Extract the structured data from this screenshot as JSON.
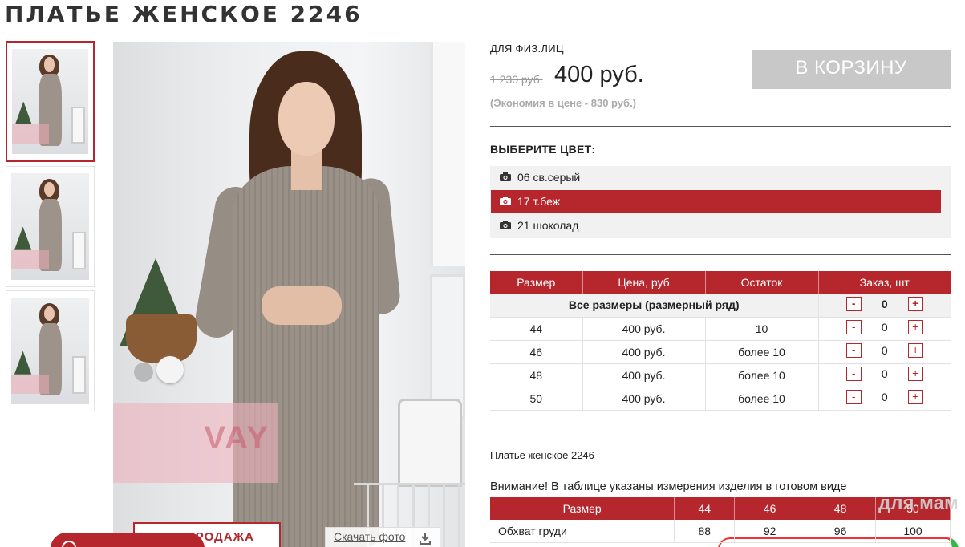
{
  "product": {
    "title": "ПЛАТЬЕ ЖЕНСКОЕ 2246",
    "audience": "ДЛЯ ФИЗ.ЛИЦ",
    "old_price": "1 230 руб.",
    "new_price": "400 руб.",
    "savings": "(Экономия в цене - 830 руб.)",
    "cart_button": "В КОРЗИНУ",
    "description": "Платье женское 2246"
  },
  "gallery": {
    "thumbnails_count": 3,
    "active_index": 0,
    "main_watermark": "VAY",
    "sale_badge": "РАСПРОДАЖА",
    "download_link": "Скачать фото"
  },
  "colors": {
    "title": "ВЫБЕРИТЕ ЦВЕТ:",
    "options": [
      {
        "label": "06 св.серый",
        "selected": false
      },
      {
        "label": "17 т.беж",
        "selected": true
      },
      {
        "label": "21 шоколад",
        "selected": false
      }
    ],
    "accent": "#b5272d"
  },
  "size_table": {
    "headers": [
      "Размер",
      "Цена, руб",
      "Остаток",
      "Заказ, шт"
    ],
    "all_sizes_label": "Все размеры (размерный ряд)",
    "all_sizes_qty": "0",
    "rows": [
      {
        "size": "44",
        "price": "400 руб.",
        "stock": "10",
        "qty": "0"
      },
      {
        "size": "46",
        "price": "400 руб.",
        "stock": "более 10",
        "qty": "0"
      },
      {
        "size": "48",
        "price": "400 руб.",
        "stock": "более 10",
        "qty": "0"
      },
      {
        "size": "50",
        "price": "400 руб.",
        "stock": "более 10",
        "qty": "0"
      }
    ],
    "minus": "-",
    "plus": "+"
  },
  "measurements": {
    "notice": "Внимание! В таблице указаны измерения изделия в готовом виде",
    "headers": [
      "Размер",
      "44",
      "46",
      "48",
      "50"
    ],
    "rows": [
      {
        "label": "Обхват груди",
        "values": [
          "88",
          "92",
          "96",
          "100"
        ]
      }
    ]
  },
  "watermark_logo": "для мам"
}
